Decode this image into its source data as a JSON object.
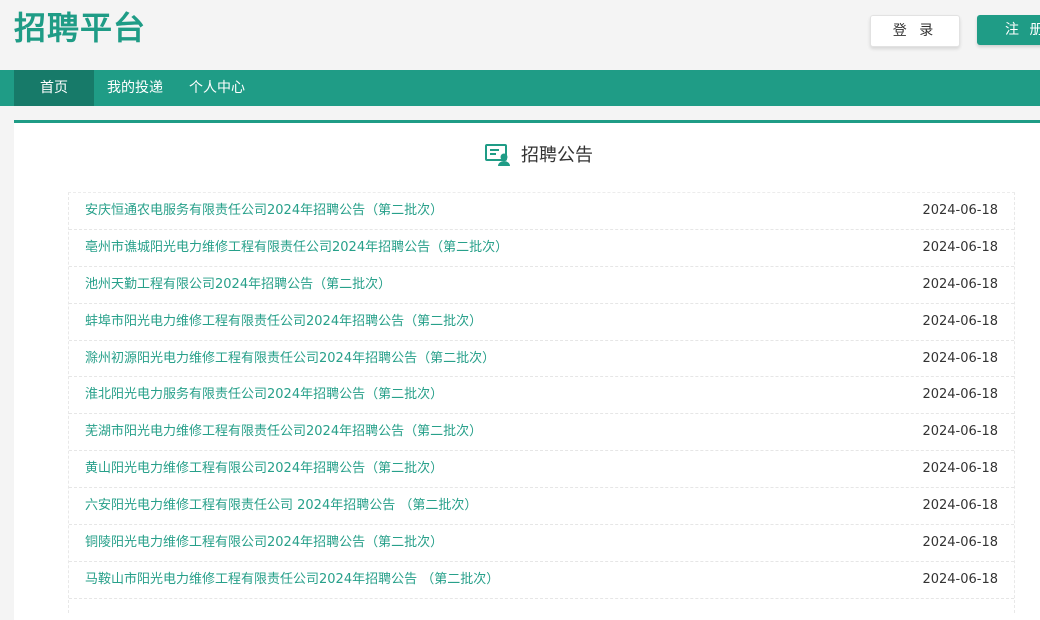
{
  "header": {
    "logo": "招聘平台",
    "login_label": "登 录",
    "register_label": "注 册"
  },
  "nav": {
    "items": [
      {
        "label": "首页",
        "active": true
      },
      {
        "label": "我的投递",
        "active": false
      },
      {
        "label": "个人中心",
        "active": false
      }
    ]
  },
  "announcements": {
    "title": "招聘公告",
    "icon": "announcement-icon",
    "items": [
      {
        "title": "安庆恒通农电服务有限责任公司2024年招聘公告（第二批次）",
        "date": "2024-06-18"
      },
      {
        "title": "亳州市谯城阳光电力维修工程有限责任公司2024年招聘公告（第二批次）",
        "date": "2024-06-18"
      },
      {
        "title": "池州天勤工程有限公司2024年招聘公告（第二批次）",
        "date": "2024-06-18"
      },
      {
        "title": "蚌埠市阳光电力维修工程有限责任公司2024年招聘公告（第二批次）",
        "date": "2024-06-18"
      },
      {
        "title": "滁州初源阳光电力维修工程有限责任公司2024年招聘公告（第二批次）",
        "date": "2024-06-18"
      },
      {
        "title": "淮北阳光电力服务有限责任公司2024年招聘公告（第二批次）",
        "date": "2024-06-18"
      },
      {
        "title": "芜湖市阳光电力维修工程有限责任公司2024年招聘公告（第二批次）",
        "date": "2024-06-18"
      },
      {
        "title": "黄山阳光电力维修工程有限公司2024年招聘公告（第二批次）",
        "date": "2024-06-18"
      },
      {
        "title": "六安阳光电力维修工程有限责任公司 2024年招聘公告 （第二批次）",
        "date": "2024-06-18"
      },
      {
        "title": "铜陵阳光电力维修工程有限公司2024年招聘公告（第二批次）",
        "date": "2024-06-18"
      },
      {
        "title": "马鞍山市阳光电力维修工程有限责任公司2024年招聘公告 （第二批次）",
        "date": "2024-06-18"
      }
    ]
  },
  "colors": {
    "brand": "#1f9c86",
    "nav_active": "#177a69",
    "link": "#27a08a"
  }
}
